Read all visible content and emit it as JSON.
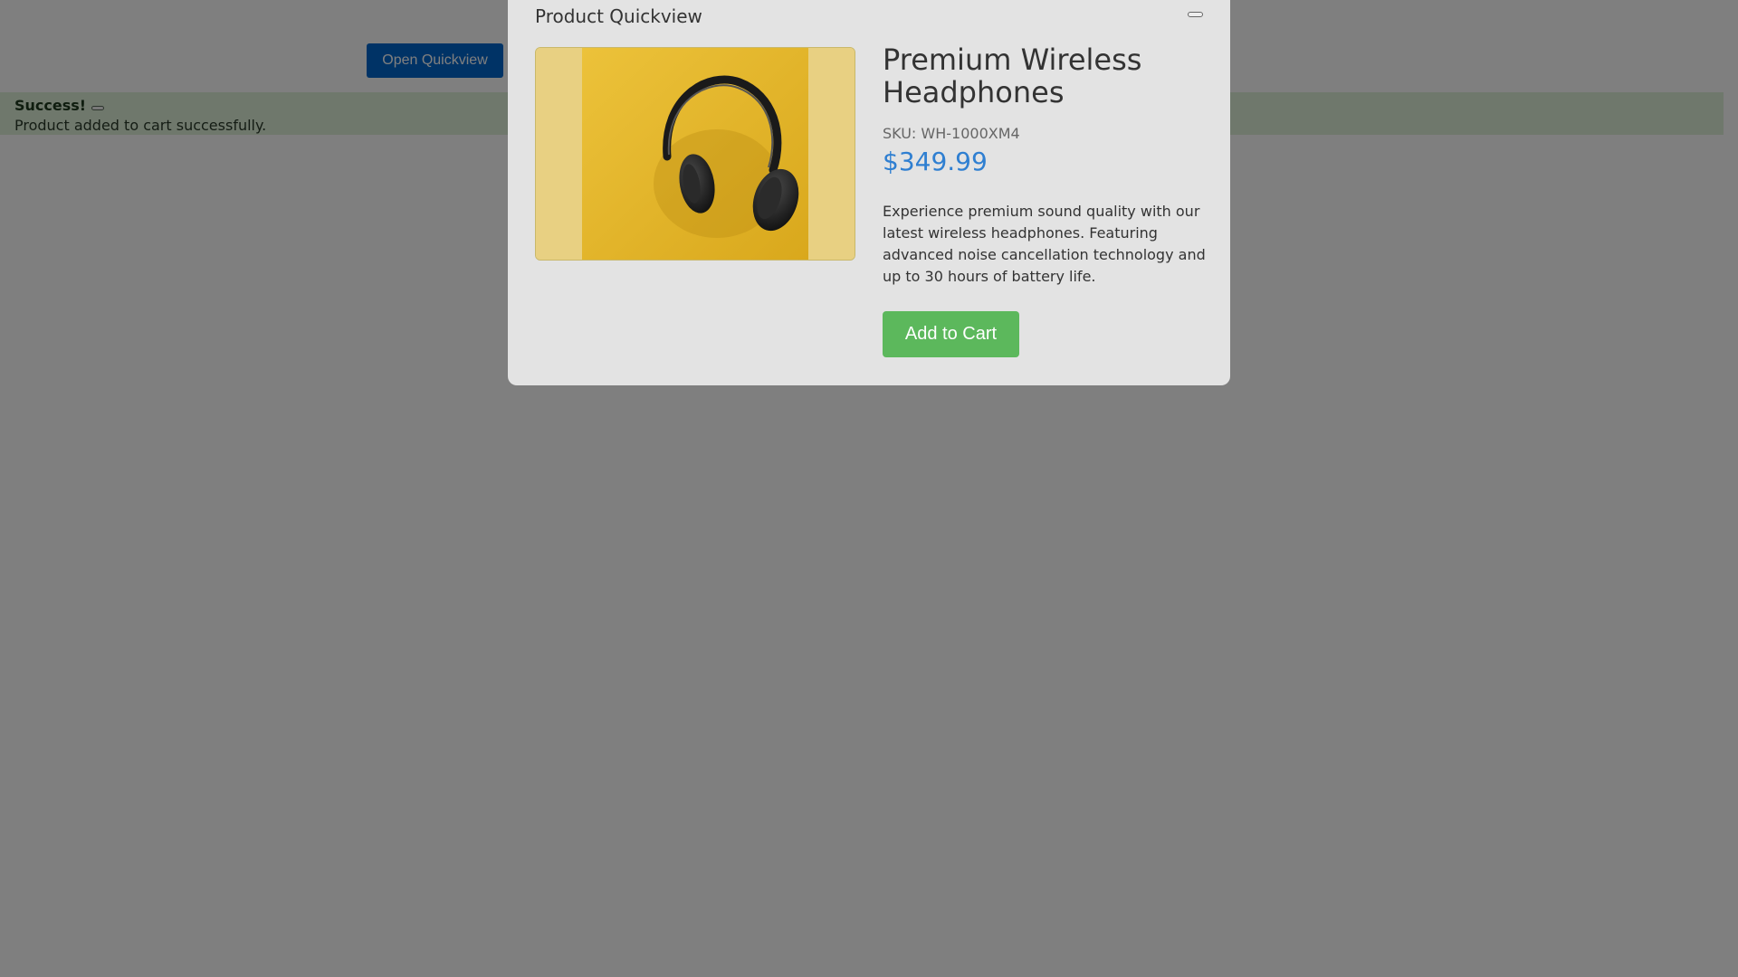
{
  "page": {
    "open_quickview_label": "Open Quickview"
  },
  "alert": {
    "title": "Success!",
    "message": "Product added to cart successfully."
  },
  "modal": {
    "title": "Product Quickview",
    "product": {
      "name": "Premium Wireless Headphones",
      "sku_label": "SKU: ",
      "sku": "WH-1000XM4",
      "price": "$349.99",
      "description": "Experience premium sound quality with our latest wireless headphones. Featuring advanced noise cancellation technology and up to 30 hours of battery life.",
      "image_icon": "headphones-photo"
    },
    "add_to_cart_label": "Add to Cart"
  },
  "colors": {
    "primary_button": "#0066cc",
    "success_button": "#5cb85c",
    "price": "#2f7fd1",
    "alert_background": "#dff0d8",
    "overlay": "rgba(0,0,0,0.5)"
  }
}
